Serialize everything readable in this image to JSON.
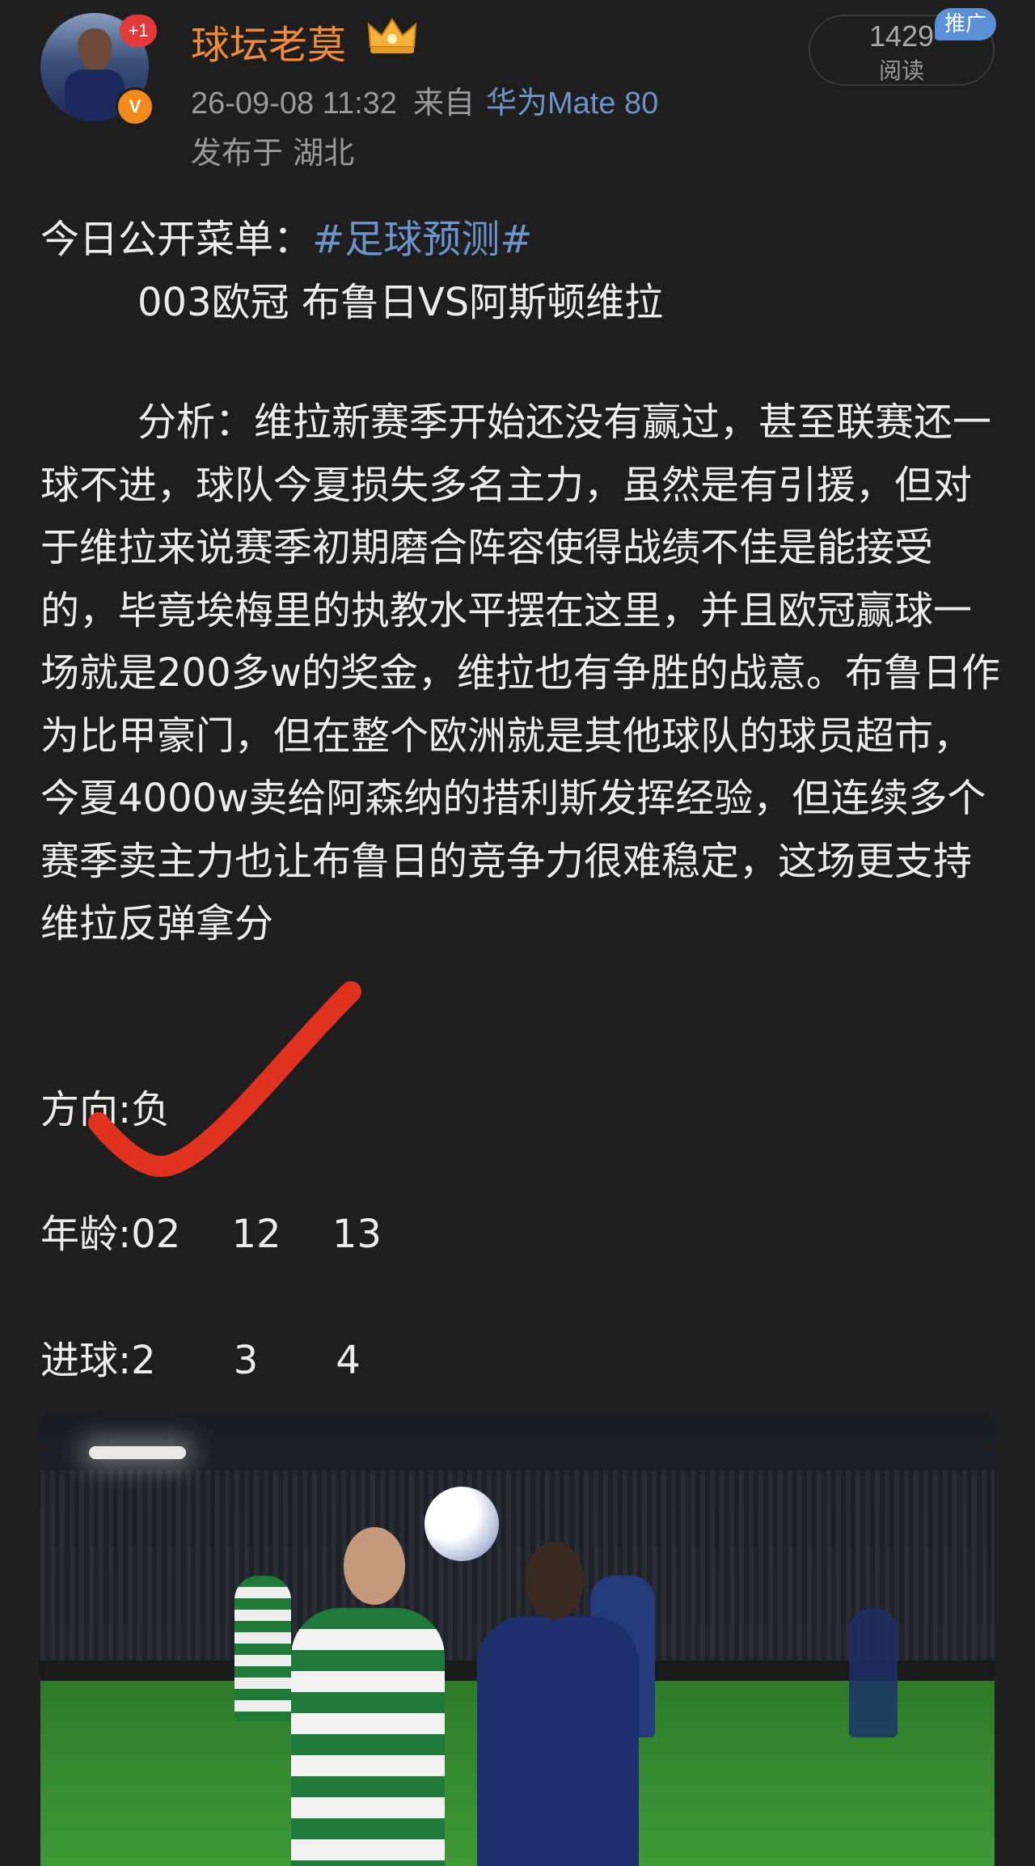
{
  "header": {
    "username": "球坛老莫",
    "follow_plus_badge": "+1",
    "verified_badge": "V",
    "timestamp": "26-09-08 11:32",
    "from_label": "来自",
    "device": "华为Mate 80",
    "location": "发布于 湖北",
    "read_count": "1429",
    "read_label": "阅读",
    "promo_tag": "推广",
    "icons": {
      "crown": "crown-icon",
      "avatar": "avatar"
    }
  },
  "post": {
    "menu_prefix": "今日公开菜单：",
    "hashtag": "#足球预测#",
    "match_line": "003欧冠 布鲁日VS阿斯顿维拉",
    "analysis": "分析：维拉新赛季开始还没有赢过，甚至联赛还一球不进，球队今夏损失多名主力，虽然是有引援，但对于维拉来说赛季初期磨合阵容使得战绩不佳是能接受的，毕竟埃梅里的执教水平摆在这里，并且欧冠赢球一场就是200多w的奖金，维拉也有争胜的战意。布鲁日作为比甲豪门，但在整个欧洲就是其他球队的球员超市，今夏4000w卖给阿森纳的措利斯发挥经验，但连续多个赛季卖主力也让布鲁日的竞争力很难稳定，这场更支持维拉反弹拿分",
    "direction": "方向:负",
    "age": "年龄:02　 12　 13",
    "goals": "进球:2　　3　　4"
  },
  "colors": {
    "background": "#1e1e1e",
    "username": "#f08a3c",
    "link": "#6e93c9",
    "check_mark": "#e0321f",
    "promo": "#5b8fd6"
  }
}
